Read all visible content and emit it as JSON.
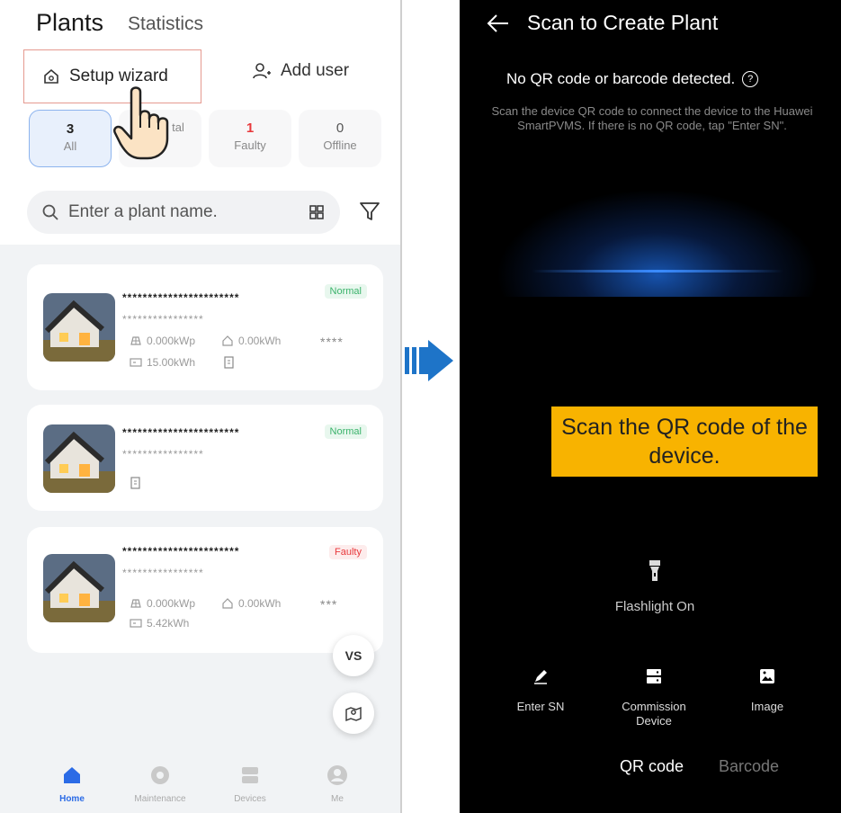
{
  "left_panel": {
    "header": {
      "title": "Plants",
      "tab": "Statistics"
    },
    "actions": {
      "setup_wizard": "Setup wizard",
      "add_user": "Add user"
    },
    "status_filters": [
      {
        "count": "3",
        "label": "All"
      },
      {
        "count": "",
        "label": "tal"
      },
      {
        "count": "1",
        "label": "Faulty"
      },
      {
        "count": "0",
        "label": "Offline"
      }
    ],
    "search": {
      "placeholder": "Enter a plant name."
    },
    "plants": [
      {
        "name": "***********************",
        "address": "****************",
        "status": "Normal",
        "capacity": "0.000kWp",
        "daily_energy": "0.00kWh",
        "total_energy": "15.00kWh",
        "extra": "****"
      },
      {
        "name": "***********************",
        "address": "****************",
        "status": "Normal"
      },
      {
        "name": "***********************",
        "address": "****************",
        "status": "Faulty",
        "capacity": "0.000kWp",
        "daily_energy": "0.00kWh",
        "total_energy": "5.42kWh",
        "extra": "***"
      }
    ],
    "floating": {
      "vs": "VS"
    },
    "bottom_nav": [
      {
        "label": "Home",
        "icon": "home-icon",
        "active": true
      },
      {
        "label": "Maintenance",
        "icon": "maintenance-icon",
        "active": false
      },
      {
        "label": "Devices",
        "icon": "devices-icon",
        "active": false
      },
      {
        "label": "Me",
        "icon": "user-icon",
        "active": false
      }
    ]
  },
  "right_panel": {
    "title": "Scan to Create Plant",
    "status_message": "No QR code or barcode detected.",
    "description": "Scan the device QR code to connect the device to the Huawei SmartPVMS. If there is no QR code, tap \"Enter SN\".",
    "callout": "Scan the QR code of the device.",
    "flashlight": "Flashlight On",
    "tools": [
      {
        "label": "Enter SN",
        "icon": "pen-icon"
      },
      {
        "label": "Commission Device",
        "icon": "server-icon"
      },
      {
        "label": "Image",
        "icon": "image-icon"
      }
    ],
    "modes": {
      "qr": "QR code",
      "barcode": "Barcode"
    }
  },
  "colors": {
    "accent": "#2b6be6",
    "normal": "#3bb36b",
    "faulty": "#e8393c",
    "callout": "#f8b300",
    "highlight_border": "#e59a90",
    "arrow": "#1e74c8"
  }
}
